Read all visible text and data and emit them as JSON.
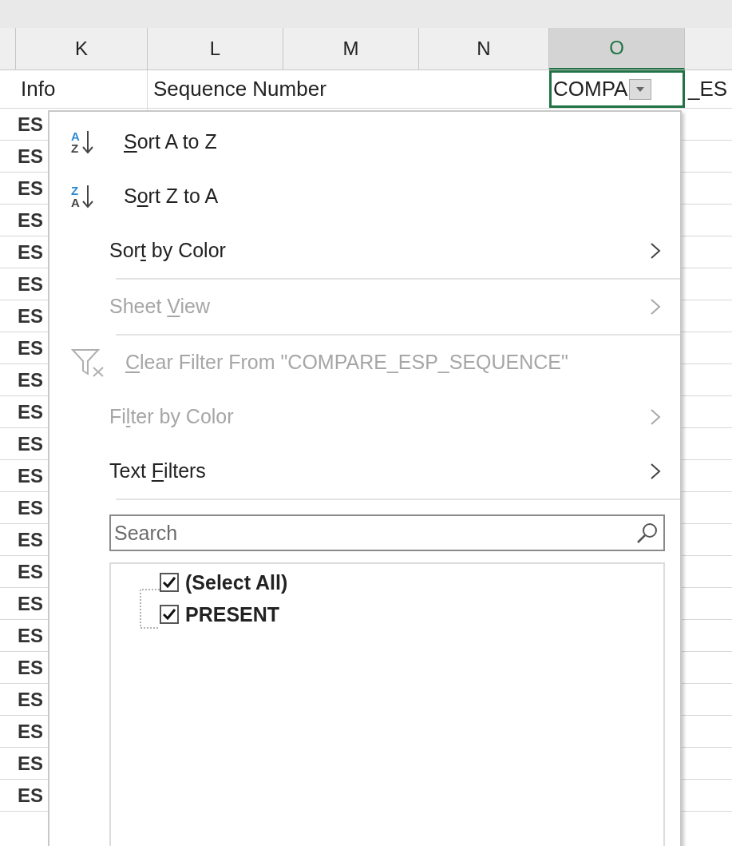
{
  "column_headers": [
    {
      "label": "K",
      "selected": false
    },
    {
      "label": "L",
      "selected": false
    },
    {
      "label": "M",
      "selected": false
    },
    {
      "label": "N",
      "selected": false
    },
    {
      "label": "O",
      "selected": true
    }
  ],
  "header_row": {
    "column_k": "Info",
    "column_l": "Sequence Number",
    "active_cell": "COMPA",
    "column_p": "_ES"
  },
  "column_k_cells": [
    "ES",
    "ES",
    "ES",
    "ES",
    "ES",
    "ES",
    "ES",
    "ES",
    "ES",
    "ES",
    "ES",
    "ES",
    "ES",
    "ES",
    "ES",
    "ES",
    "ES",
    "ES",
    "ES",
    "ES",
    "ES",
    "ES"
  ],
  "filter_menu": {
    "items": [
      {
        "kind": "sort",
        "icon_top": "A",
        "icon_bottom": "Z",
        "label_parts": [
          {
            "text": "S",
            "underlined": true
          },
          {
            "text": "ort A to Z",
            "underlined": false
          }
        ],
        "disabled": false,
        "submenu": false,
        "separator_after": false
      },
      {
        "kind": "sort",
        "icon_top": "Z",
        "icon_bottom": "A",
        "label_parts": [
          {
            "text": "S",
            "underlined": false
          },
          {
            "text": "o",
            "underlined": true
          },
          {
            "text": "rt Z to A",
            "underlined": false
          }
        ],
        "disabled": false,
        "submenu": false,
        "separator_after": false
      },
      {
        "kind": "plain",
        "label_parts": [
          {
            "text": "Sor",
            "underlined": false
          },
          {
            "text": "t",
            "underlined": true
          },
          {
            "text": " by Color",
            "underlined": false
          }
        ],
        "disabled": false,
        "submenu": true,
        "separator_after": true
      },
      {
        "kind": "plain",
        "label_parts": [
          {
            "text": "Sheet ",
            "underlined": false
          },
          {
            "text": "V",
            "underlined": true
          },
          {
            "text": "iew",
            "underlined": false
          }
        ],
        "disabled": true,
        "submenu": true,
        "separator_after": true
      },
      {
        "kind": "clear_filter",
        "label_parts": [
          {
            "text": "C",
            "underlined": true
          },
          {
            "text": "lear Filter From \"COMPARE_ESP_SEQUENCE\"",
            "underlined": false
          }
        ],
        "disabled": true,
        "submenu": false,
        "separator_after": false
      },
      {
        "kind": "plain",
        "label_parts": [
          {
            "text": "Fi",
            "underlined": false
          },
          {
            "text": "l",
            "underlined": true
          },
          {
            "text": "ter by Color",
            "underlined": false
          }
        ],
        "disabled": true,
        "submenu": true,
        "separator_after": false
      },
      {
        "kind": "plain",
        "label_parts": [
          {
            "text": "Text ",
            "underlined": false
          },
          {
            "text": "F",
            "underlined": true
          },
          {
            "text": "ilters",
            "underlined": false
          }
        ],
        "disabled": false,
        "submenu": true,
        "separator_after": true
      }
    ],
    "search": {
      "placeholder": "Search"
    },
    "values": [
      {
        "label": "(Select All)",
        "checked": true
      },
      {
        "label": "PRESENT",
        "checked": true
      }
    ]
  }
}
